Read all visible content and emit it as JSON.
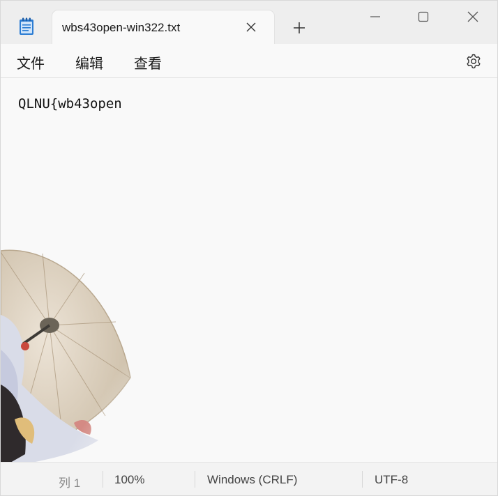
{
  "tab": {
    "title": "wbs43open-win322.txt"
  },
  "menu": {
    "file": "文件",
    "edit": "编辑",
    "view": "查看"
  },
  "editor": {
    "content": "QLNU{wb43open"
  },
  "status": {
    "position": "列 1",
    "zoom": "100%",
    "line_ending": "Windows (CRLF)",
    "encoding": "UTF-8"
  },
  "icons": {
    "app": "notepad-icon",
    "tab_close": "close-icon",
    "new_tab": "plus-icon",
    "minimize": "minimize-icon",
    "maximize": "maximize-icon",
    "close": "close-icon",
    "settings": "gear-icon"
  },
  "colors": {
    "accent": "#2b7cd3",
    "background": "#f9f9f9"
  }
}
